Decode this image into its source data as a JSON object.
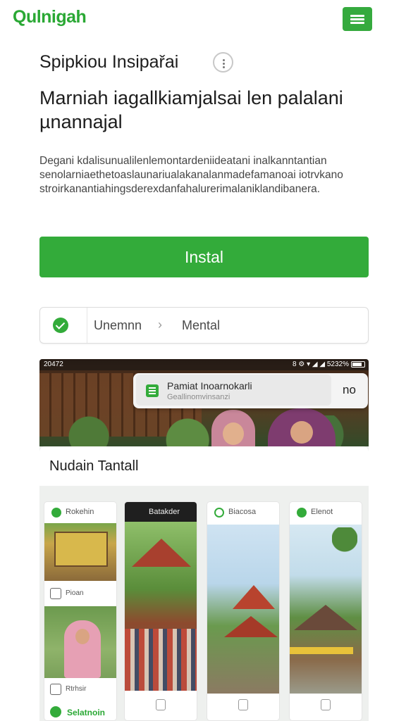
{
  "header": {
    "logo": "Qulnigah",
    "menu_icon": "hamburger-menu-icon",
    "accent_color": "#33ab3a"
  },
  "intro": {
    "subtitle": "Spipkiou Insipařai",
    "headline": "Marniah iagallkiamjalsai len palalani µnannajal",
    "description": "Degani kdalisunualilenlemontardeniideatani inalkanntantian senolarniaethetoaslaunariualakanalanmadefamanoai iotrvkano stroirkanantiahingsderexdanfahalurerimalaniklandibanera."
  },
  "install_button": {
    "label": "Instal"
  },
  "breadcrumb": {
    "items": [
      "Unemnn",
      "Mental"
    ],
    "separator": "›"
  },
  "screenshot": {
    "status_time": "20472",
    "status_right": "8 ⚙ ▾ ◢ ◢ 5232%",
    "notification": {
      "title": "Pamiat Inoarnokarli",
      "subtitle": "Geallinomvinsanzi",
      "action": "no"
    },
    "section_title": "Nudain Tantall",
    "cards": [
      {
        "header_label": "Rokehin",
        "caption1": "Pioan",
        "caption2": "Rtrhsir",
        "footer_label": "Selatnoin"
      },
      {
        "header_label": "Batakder"
      },
      {
        "header_label": "Biacosa"
      },
      {
        "header_label": "Elenot"
      }
    ]
  }
}
